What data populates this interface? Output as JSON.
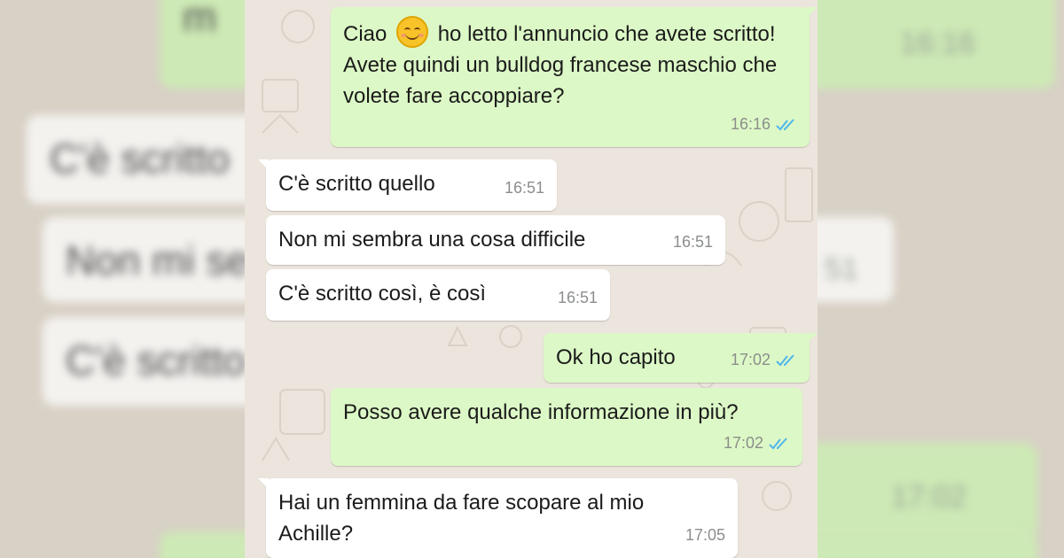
{
  "background_text": {
    "left_1": "C'è scritto",
    "left_2": "Non mi se",
    "left_3": "C'è scritto",
    "right_time_1": "16:16",
    "right_time_2": "51",
    "right_time_3": "17:02",
    "top_text": "m"
  },
  "colors": {
    "incoming_bubble": "#ffffff",
    "outgoing_bubble": "#dcf8c6",
    "chat_background": "#ece5dd",
    "read_ticks": "#4fb6ec"
  },
  "messages": [
    {
      "direction": "outgoing",
      "text_before_emoji": "Ciao ",
      "emoji": "smiling-face-icon",
      "text_after_emoji": " ho letto l'annuncio che avete scritto! Avete quindi un bulldog francese maschio che volete fare accoppiare?",
      "time": "16:16",
      "status": "read"
    },
    {
      "direction": "incoming",
      "text": "C'è scritto quello",
      "time": "16:51"
    },
    {
      "direction": "incoming",
      "text": "Non mi sembra una cosa difficile",
      "time": "16:51"
    },
    {
      "direction": "incoming",
      "text": "C'è scritto così, è così",
      "time": "16:51"
    },
    {
      "direction": "outgoing",
      "text": "Ok ho capito",
      "time": "17:02",
      "status": "read"
    },
    {
      "direction": "outgoing",
      "text": "Posso avere qualche informazione in più?",
      "time": "17:02",
      "status": "read"
    },
    {
      "direction": "incoming",
      "text": "Hai un femmina da fare scopare al mio Achille?",
      "time": "17:05"
    }
  ]
}
